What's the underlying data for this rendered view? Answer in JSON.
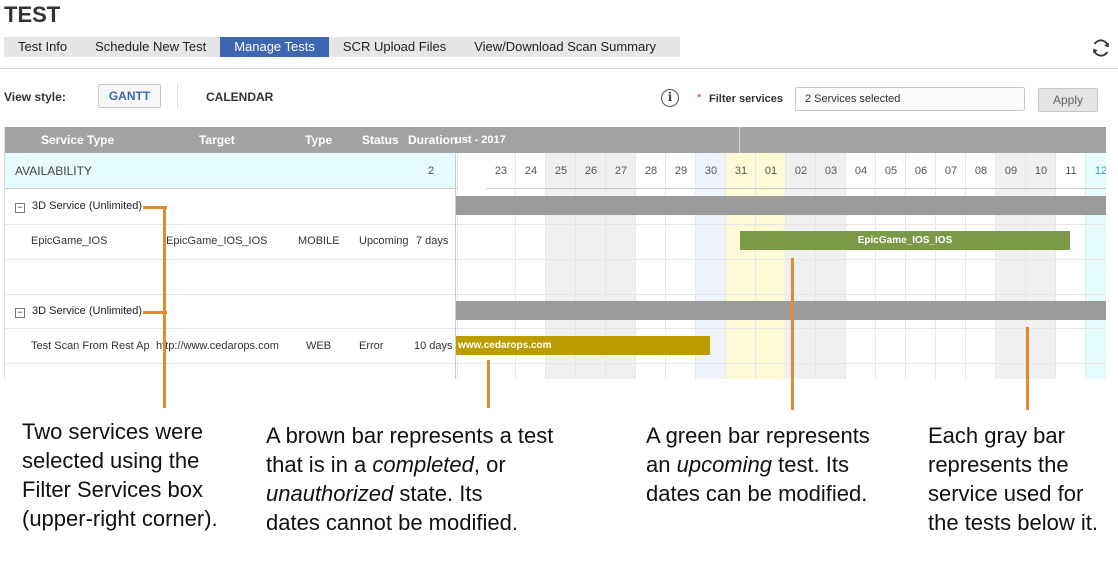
{
  "title": "TEST",
  "tabs": [
    {
      "label": "Test Info"
    },
    {
      "label": "Schedule New Test"
    },
    {
      "label": "Manage Tests"
    },
    {
      "label": "SCR Upload Files"
    },
    {
      "label": "View/Download Scan Summary"
    }
  ],
  "active_tab": "Manage Tests",
  "toolbar": {
    "view_style_label": "View style:",
    "gantt_label": "GANTT",
    "calendar_label": "CALENDAR",
    "required_marker": "*",
    "filter_label": "Filter services",
    "filter_value": "2 Services selected",
    "apply_label": "Apply"
  },
  "grid": {
    "columns": [
      "Service Type",
      "Target",
      "Type",
      "Status",
      "Duration"
    ],
    "month_label": "ust - 2017",
    "availability_label": "AVAILABILITY",
    "days": [
      "2",
      "23",
      "24",
      "25",
      "26",
      "27",
      "28",
      "29",
      "30",
      "31",
      "01",
      "02",
      "03",
      "04",
      "05",
      "06",
      "07",
      "08",
      "09",
      "10",
      "11",
      "12"
    ],
    "services": [
      {
        "name": "3D Service (Unlimited)",
        "tests": [
          {
            "name": "EpicGame_IOS",
            "target": "EpicGame_IOS_IOS",
            "type": "MOBILE",
            "status": "Upcoming",
            "duration": "7 days",
            "bar_label": "EpicGame_IOS_IOS"
          }
        ]
      },
      {
        "name": "3D Service (Unlimited)",
        "tests": [
          {
            "name": "Test Scan From Rest Ap",
            "target": "http://www.cedarops.com",
            "type": "WEB",
            "status": "Error",
            "duration": "10 days",
            "bar_label": "www.cedarops.com"
          }
        ]
      }
    ]
  },
  "annotations": {
    "services": [
      "Two services were",
      "selected using the",
      "Filter Services box",
      "(upper-right corner)."
    ],
    "brown": {
      "l1": "A brown bar represents a test",
      "l2a": "that is in a ",
      "l2b": "completed",
      "l2c": ", or",
      "l3a": "unauthorized",
      "l3b": " state. Its",
      "l4": "dates cannot be modified."
    },
    "green": {
      "l1": "A green bar represents",
      "l2a": "an ",
      "l2b": "upcoming",
      "l2c": " test. Its",
      "l3": "dates can be modified."
    },
    "gray": [
      "Each gray bar",
      "represents the",
      "service used for",
      "the tests below it."
    ]
  },
  "colors": {
    "active_tab": "#3e67b1",
    "header": "#a3a3a3",
    "gray_bar": "#9b9b9b",
    "green_bar": "#7a9a48",
    "brown_bar": "#bb9d00",
    "annotation_line": "#e28b2f",
    "availability_bg": "#e6fbfb"
  }
}
